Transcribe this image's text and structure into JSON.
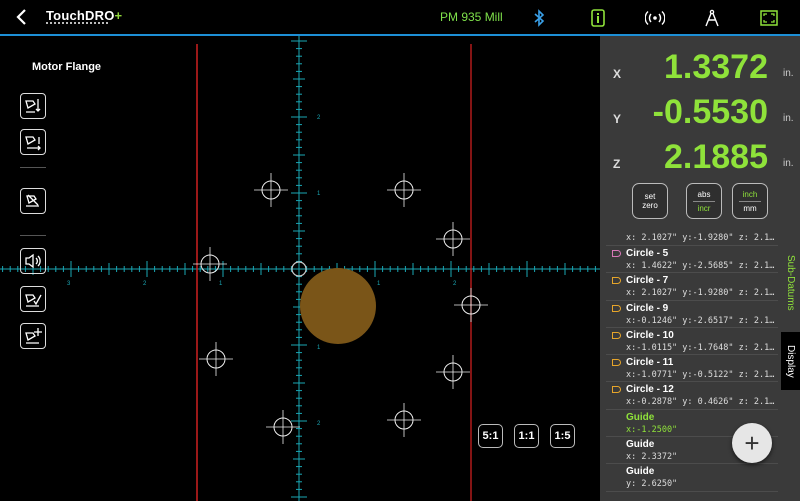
{
  "header": {
    "logo_main": "TouchDRO",
    "logo_plus": "+",
    "machine_name": "PM 935 Mill",
    "icons": [
      "bluetooth-icon",
      "info-icon",
      "signal-icon",
      "compass-icon",
      "fullscreen-icon"
    ]
  },
  "canvas": {
    "title": "Motor Flange",
    "tick_labels": {
      "x_pos": [
        "1",
        "2"
      ],
      "x_neg": [
        "1",
        "2",
        "3"
      ],
      "y_pos": [
        "1",
        "2"
      ],
      "y_neg": [
        "1",
        "2"
      ]
    },
    "zoom_buttons": [
      "5:1",
      "1:1",
      "1:5"
    ]
  },
  "readout": {
    "x_label": "X",
    "x_value": "1.3372",
    "y_label": "Y",
    "y_value": "-0.5530",
    "z_label": "Z",
    "z_value": "2.1885",
    "unit": "in.",
    "set_zero": [
      "set",
      "zero"
    ],
    "abs_incr": [
      "abs",
      "incr"
    ],
    "inch_mm": [
      "inch",
      "mm"
    ],
    "accent": "#8fe23a"
  },
  "list": {
    "partial_coords": "x: 2.1027\" y:-1.9280\" z: 2.1…",
    "items": [
      {
        "name": "Circle - 5",
        "coords": "x: 1.4622\" y:-2.5685\" z: 2.1…",
        "tag": "pink"
      },
      {
        "name": "Circle - 7",
        "coords": "x: 2.1027\" y:-1.9280\" z: 2.1…",
        "tag": "orange"
      },
      {
        "name": "Circle - 9",
        "coords": "x:-0.1246\" y:-2.6517\" z: 2.1…",
        "tag": "orange"
      },
      {
        "name": "Circle - 10",
        "coords": "x:-1.0115\" y:-1.7648\" z: 2.1…",
        "tag": "orange"
      },
      {
        "name": "Circle - 11",
        "coords": "x:-1.0771\" y:-0.5122\" z: 2.1…",
        "tag": "orange"
      },
      {
        "name": "Circle - 12",
        "coords": "x:-0.2878\" y: 0.4626\" z: 2.1…",
        "tag": "orange"
      },
      {
        "name": "Guide",
        "coords": "x:-1.2500\"",
        "tag": "none"
      },
      {
        "name": "Guide",
        "coords": "x: 2.3372\"",
        "tag": "none"
      },
      {
        "name": "Guide",
        "coords": "y: 2.6250\"",
        "tag": "none"
      }
    ]
  },
  "side_tabs": {
    "sub_datums": "Sub-Datums",
    "display": "Display"
  },
  "fab_label": "+"
}
